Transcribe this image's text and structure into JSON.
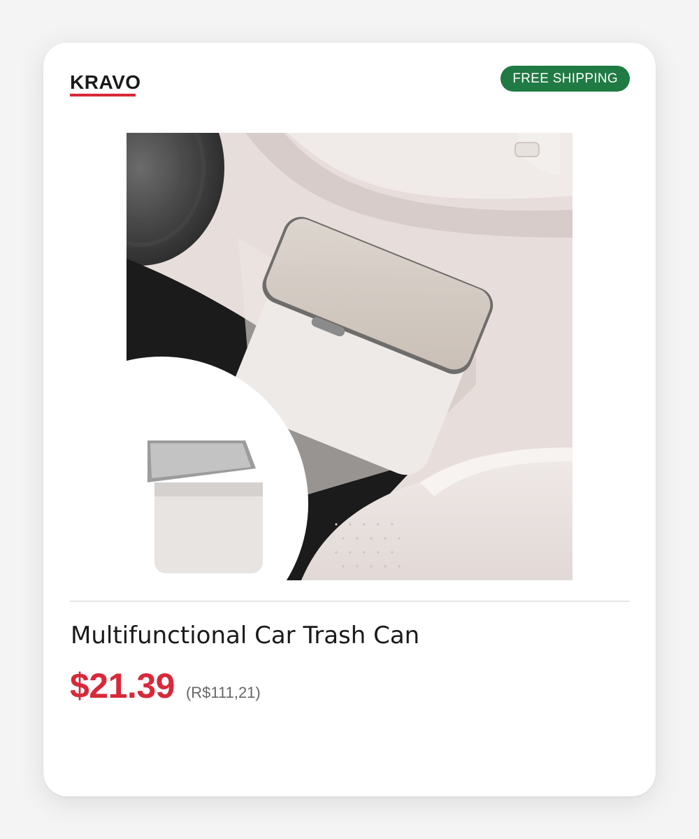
{
  "product_card": {
    "brand": "KRAVO",
    "badge": "FREE SHIPPING",
    "title": "Multifunctional Car Trash Can",
    "price": "$21.39",
    "price_converted": "(R$111,21)"
  },
  "colors": {
    "accent_red": "#d8293a",
    "badge_green": "#1f7a43",
    "text_dark": "#1a1a1a",
    "text_muted": "#666666"
  }
}
